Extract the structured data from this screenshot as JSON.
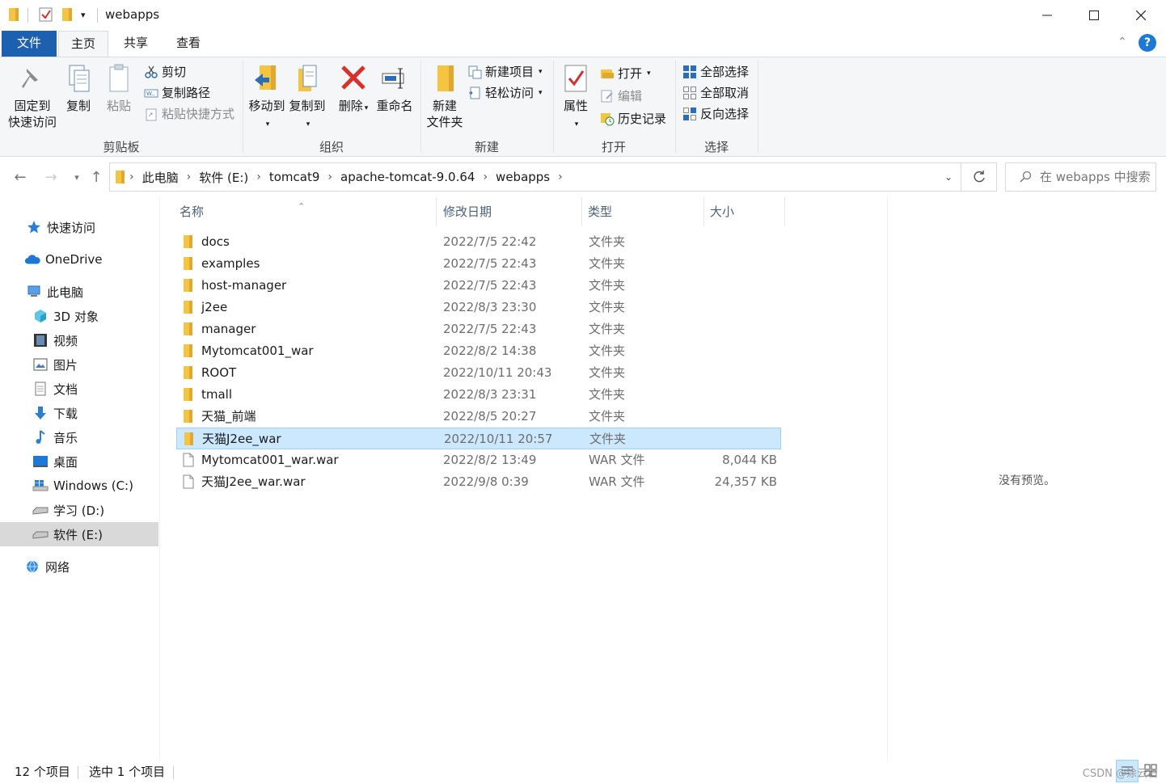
{
  "window": {
    "title": "webapps",
    "minimize_icon": "minimize-icon",
    "maximize_icon": "maximize-icon",
    "close_icon": "close-icon"
  },
  "tabs": [
    {
      "label": "文件"
    },
    {
      "label": "主页"
    },
    {
      "label": "共享"
    },
    {
      "label": "查看"
    }
  ],
  "ribbon": {
    "clipboard": {
      "group": "剪贴板",
      "pin_line1": "固定到",
      "pin_line2": "快速访问",
      "copy": "复制",
      "paste": "粘贴",
      "cut": "剪切",
      "copy_path": "复制路径",
      "paste_shortcut": "粘贴快捷方式"
    },
    "organize": {
      "group": "组织",
      "move_to": "移动到",
      "copy_to": "复制到",
      "delete": "删除",
      "rename": "重命名"
    },
    "new": {
      "group": "新建",
      "new_folder_line1": "新建",
      "new_folder_line2": "文件夹",
      "new_item": "新建项目",
      "easy_access": "轻松访问"
    },
    "open": {
      "group": "打开",
      "properties": "属性",
      "open": "打开",
      "edit": "编辑",
      "history": "历史记录"
    },
    "select": {
      "group": "选择",
      "select_all": "全部选择",
      "select_none": "全部取消",
      "invert": "反向选择"
    }
  },
  "address": {
    "crumbs": [
      "此电脑",
      "软件 (E:)",
      "tomcat9",
      "apache-tomcat-9.0.64",
      "webapps"
    ],
    "search_placeholder": "在 webapps 中搜索"
  },
  "navpane": [
    {
      "label": "快速访问",
      "icon": "star-icon"
    },
    {
      "label": "OneDrive",
      "icon": "cloud-icon"
    },
    {
      "label": "此电脑",
      "icon": "computer-icon"
    },
    {
      "label": "3D 对象",
      "icon": "cube-icon"
    },
    {
      "label": "视频",
      "icon": "video-icon"
    },
    {
      "label": "图片",
      "icon": "picture-icon"
    },
    {
      "label": "文档",
      "icon": "document-icon"
    },
    {
      "label": "下载",
      "icon": "download-icon"
    },
    {
      "label": "音乐",
      "icon": "music-icon"
    },
    {
      "label": "桌面",
      "icon": "desktop-icon"
    },
    {
      "label": "Windows (C:)",
      "icon": "drive-icon"
    },
    {
      "label": "学习 (D:)",
      "icon": "drive-icon"
    },
    {
      "label": "软件 (E:)",
      "icon": "drive-icon"
    },
    {
      "label": "网络",
      "icon": "network-icon"
    }
  ],
  "columns": {
    "name": "名称",
    "date": "修改日期",
    "type": "类型",
    "size": "大小"
  },
  "files": [
    {
      "name": "docs",
      "date": "2022/7/5 22:42",
      "type": "文件夹",
      "size": "",
      "kind": "folder"
    },
    {
      "name": "examples",
      "date": "2022/7/5 22:43",
      "type": "文件夹",
      "size": "",
      "kind": "folder"
    },
    {
      "name": "host-manager",
      "date": "2022/7/5 22:43",
      "type": "文件夹",
      "size": "",
      "kind": "folder"
    },
    {
      "name": "j2ee",
      "date": "2022/8/3 23:30",
      "type": "文件夹",
      "size": "",
      "kind": "folder"
    },
    {
      "name": "manager",
      "date": "2022/7/5 22:43",
      "type": "文件夹",
      "size": "",
      "kind": "folder"
    },
    {
      "name": "Mytomcat001_war",
      "date": "2022/8/2 14:38",
      "type": "文件夹",
      "size": "",
      "kind": "folder"
    },
    {
      "name": "ROOT",
      "date": "2022/10/11 20:43",
      "type": "文件夹",
      "size": "",
      "kind": "folder"
    },
    {
      "name": "tmall",
      "date": "2022/8/3 23:31",
      "type": "文件夹",
      "size": "",
      "kind": "folder"
    },
    {
      "name": "天猫_前端",
      "date": "2022/8/5 20:27",
      "type": "文件夹",
      "size": "",
      "kind": "folder"
    },
    {
      "name": "天猫J2ee_war",
      "date": "2022/10/11 20:57",
      "type": "文件夹",
      "size": "",
      "kind": "folder",
      "selected": true
    },
    {
      "name": "Mytomcat001_war.war",
      "date": "2022/8/2 13:49",
      "type": "WAR 文件",
      "size": "8,044 KB",
      "kind": "file"
    },
    {
      "name": "天猫J2ee_war.war",
      "date": "2022/9/8 0:39",
      "type": "WAR 文件",
      "size": "24,357 KB",
      "kind": "file"
    }
  ],
  "preview": {
    "text": "没有预览。"
  },
  "status": {
    "count": "12 个项目",
    "selected": "选中 1 个项目",
    "watermark": "CSDN @涂云石"
  },
  "colors": {
    "accent": "#1e60b0",
    "selection": "#cce8ff",
    "folder": "#f5c542"
  }
}
